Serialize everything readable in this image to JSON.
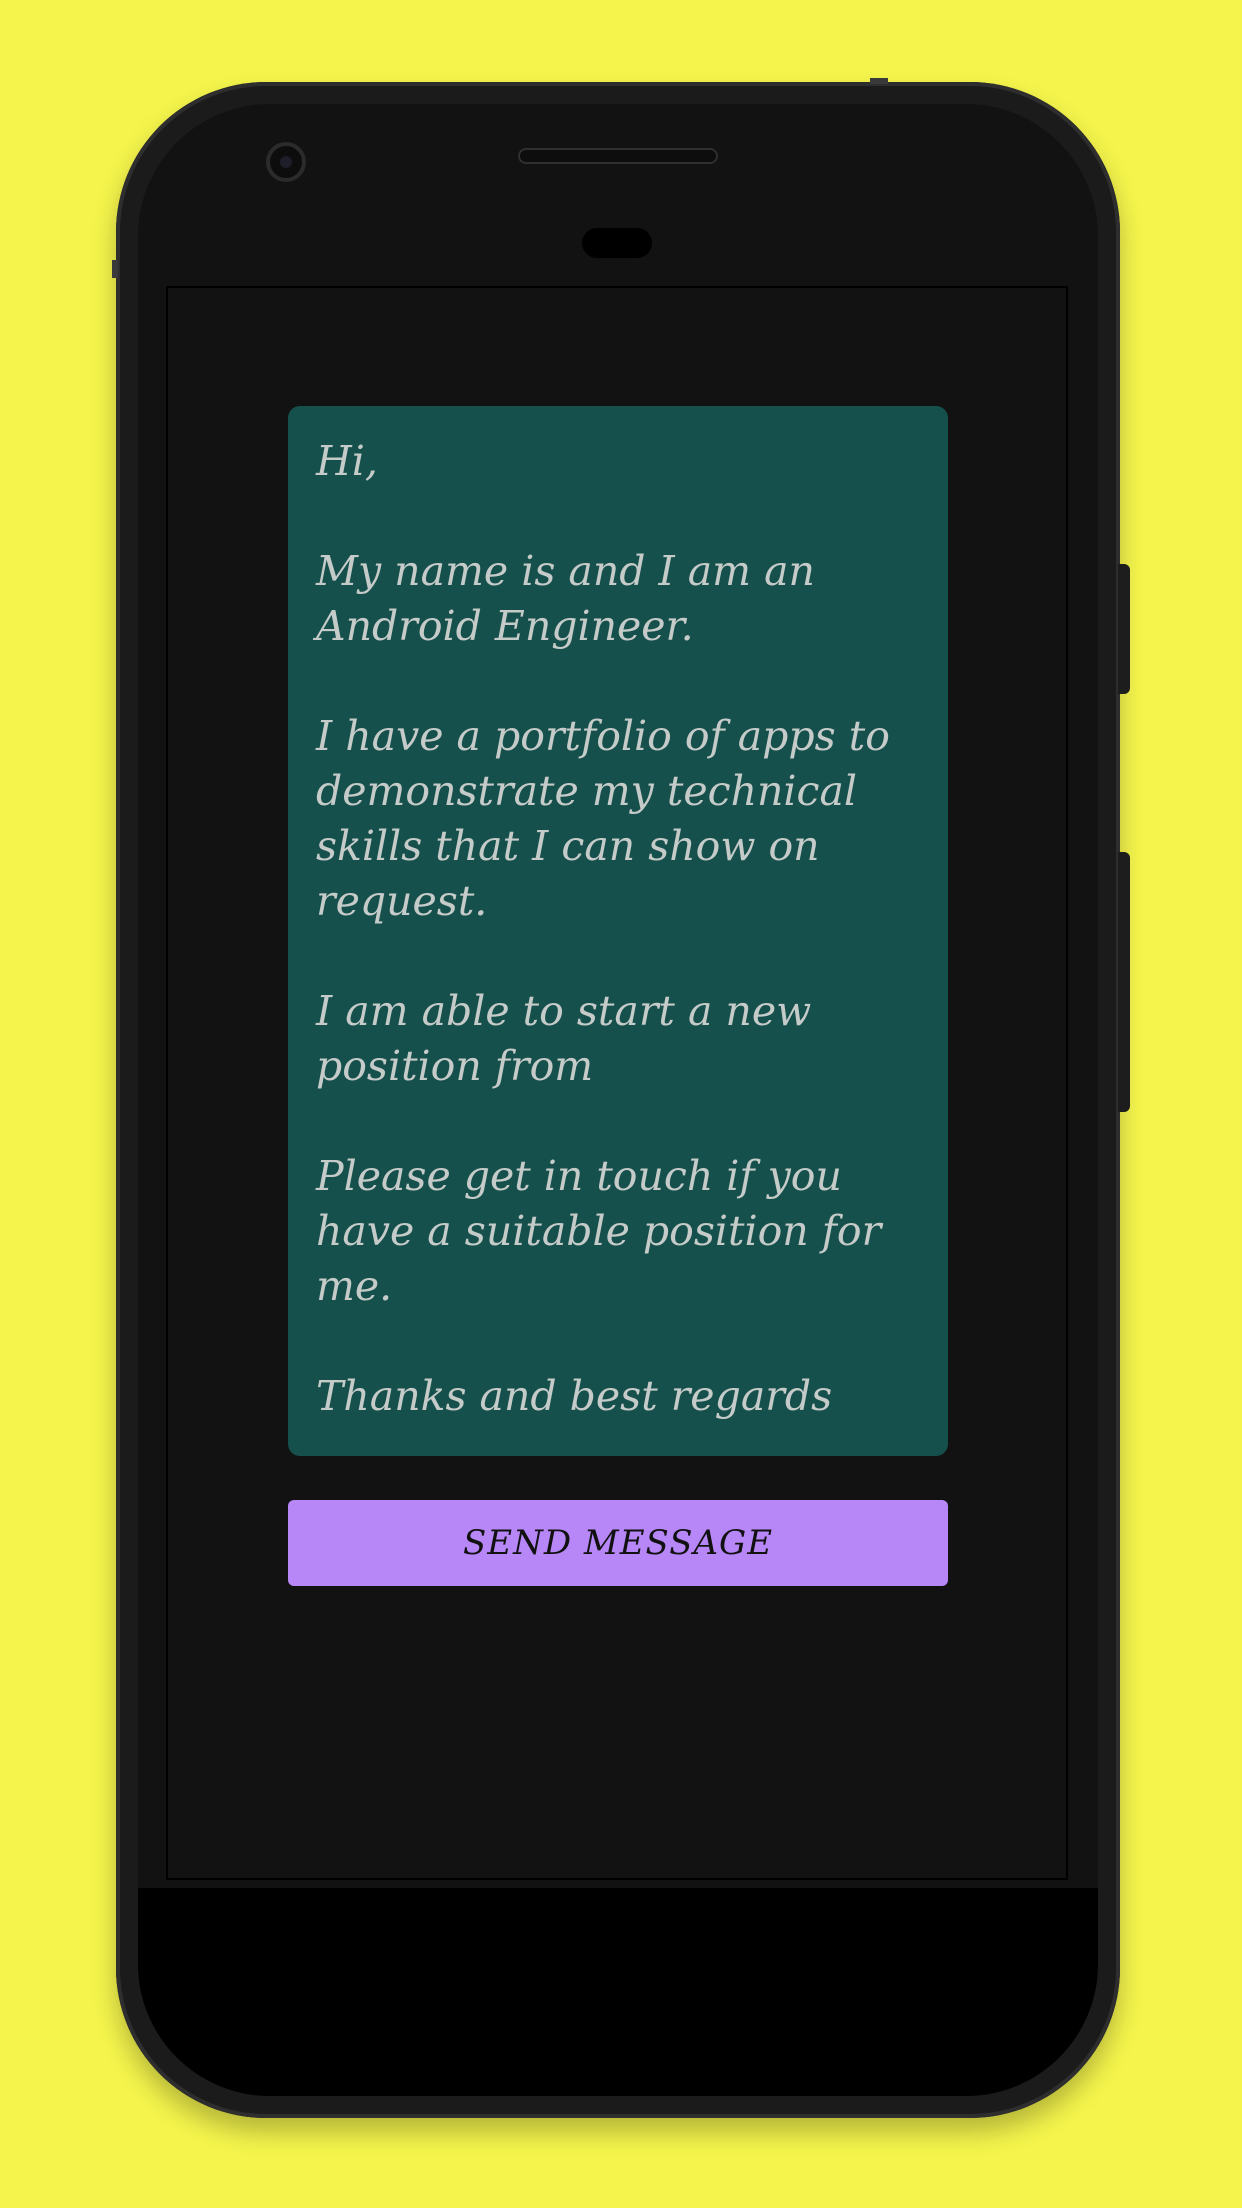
{
  "message": {
    "greeting": "Hi,",
    "intro": "My name is  and I am an Android Engineer.",
    "portfolio": "I have a portfolio of apps to demonstrate my technical skills that I can show on request.",
    "availability": "I am able to start a new position from",
    "request": "Please get in touch if you have a suitable position for me.",
    "signoff": "Thanks and best regards"
  },
  "actions": {
    "send_label": "SEND MESSAGE"
  },
  "colors": {
    "background": "#f4f44c",
    "card": "#16504c",
    "card_text": "#c5cbc9",
    "button": "#b887f7",
    "screen": "#121212"
  }
}
